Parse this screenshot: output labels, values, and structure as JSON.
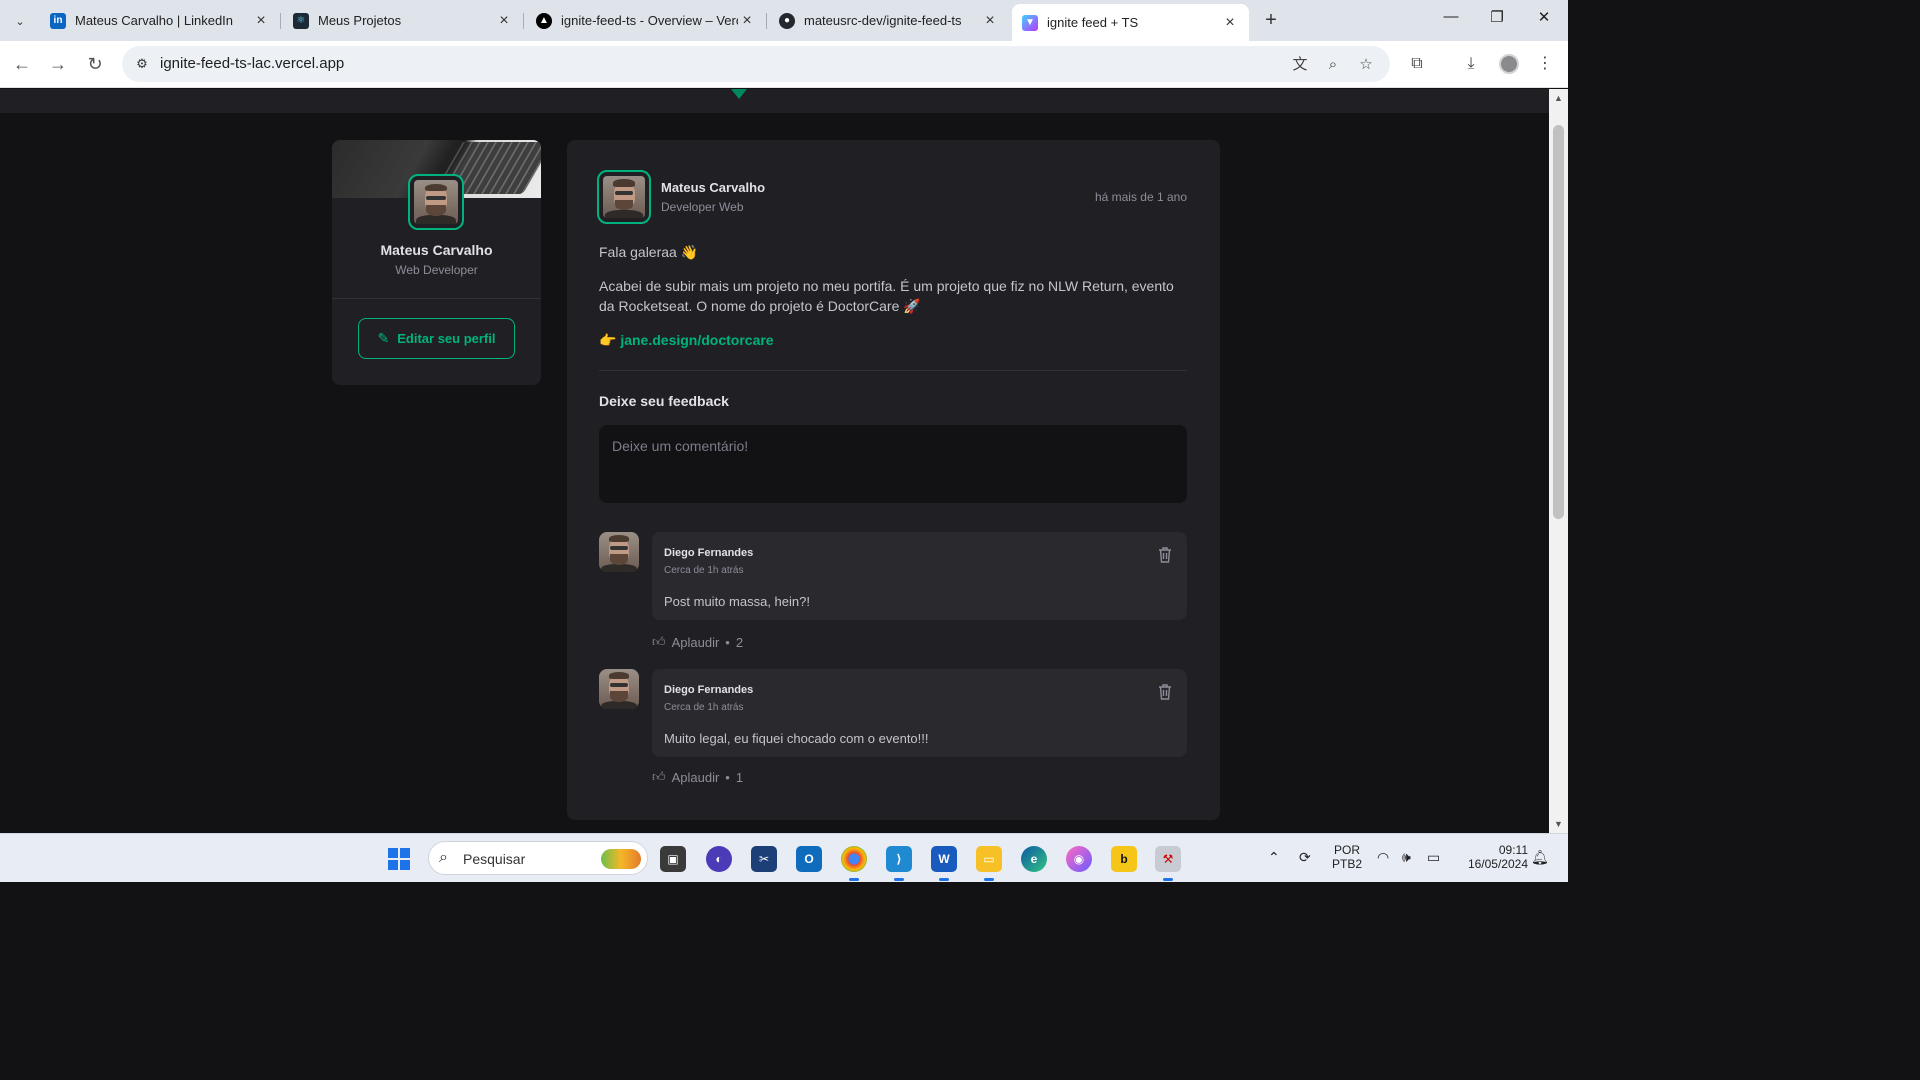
{
  "browser": {
    "tabs": [
      {
        "title": "Mateus Carvalho | LinkedIn",
        "favicon": "linkedin-icon",
        "favicon_color": "#0a66c2",
        "active": false
      },
      {
        "title": "Meus Projetos",
        "favicon": "react-icon",
        "favicon_color": "#1b2a36",
        "active": false
      },
      {
        "title": "ignite-feed-ts - Overview – Vercel",
        "favicon": "vercel-icon",
        "favicon_color": "#000000",
        "active": false
      },
      {
        "title": "mateusrc-dev/ignite-feed-ts",
        "favicon": "github-icon",
        "favicon_color": "#24292f",
        "active": false
      },
      {
        "title": "ignite feed + TS",
        "favicon": "vite-icon",
        "favicon_color": "#a259ff",
        "active": true
      }
    ],
    "url": "ignite-feed-ts-lac.vercel.app"
  },
  "profile": {
    "name": "Mateus Carvalho",
    "role": "Web Developer",
    "edit_button": "Editar seu perfil"
  },
  "post": {
    "author": "Mateus Carvalho",
    "author_role": "Developer Web",
    "time": "há mais de 1 ano",
    "greeting": "Fala galeraa 👋",
    "body": "Acabei de subir mais um projeto no meu portifa. É um projeto que fiz no NLW Return, evento da Rocketseat. O nome do projeto é DoctorCare 🚀",
    "link_prefix": "👉",
    "link": "jane.design/doctorcare",
    "feedback_title": "Deixe seu feedback",
    "comment_placeholder": "Deixe um comentário!"
  },
  "comments": [
    {
      "author": "Diego Fernandes",
      "time": "Cerca de 1h atrás",
      "text": "Post muito massa, hein?!",
      "applaud_label": "Aplaudir",
      "applaud_count": "2"
    },
    {
      "author": "Diego Fernandes",
      "time": "Cerca de 1h atrás",
      "text": "Muito legal, eu fiquei chocado com o evento!!!",
      "applaud_label": "Aplaudir",
      "applaud_count": "1"
    }
  ],
  "taskbar": {
    "search_placeholder": "Pesquisar",
    "language": "POR",
    "keyboard": "PTB2",
    "time": "09:11",
    "date": "16/05/2024"
  },
  "colors": {
    "accent": "#00b37e",
    "background": "#121214",
    "card": "#202024"
  }
}
